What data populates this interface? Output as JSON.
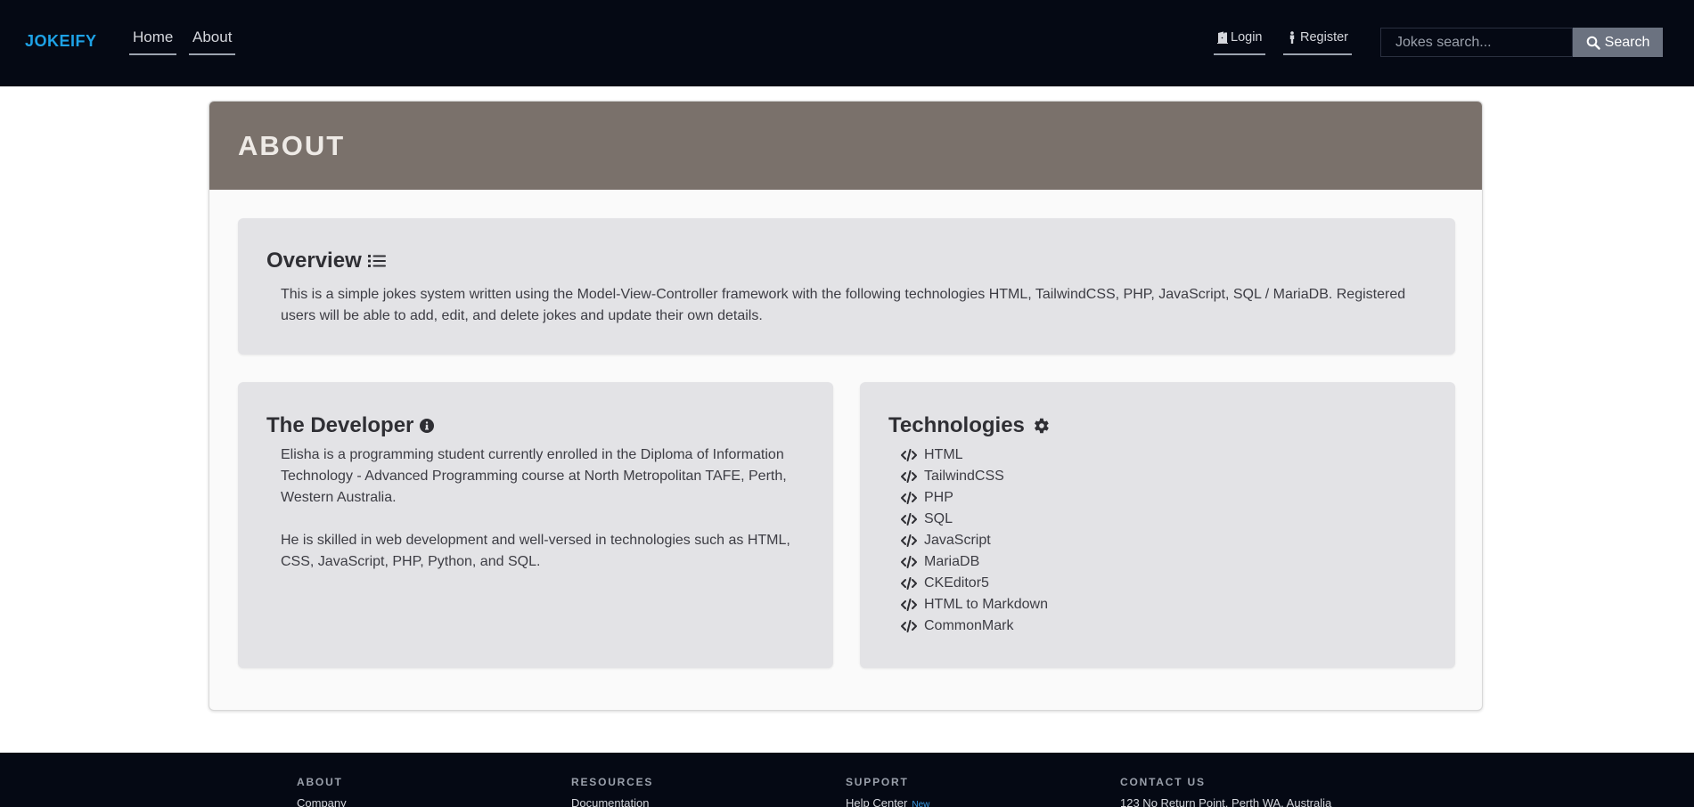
{
  "header": {
    "brand": "JOKEIFY",
    "nav": [
      {
        "label": "Home"
      },
      {
        "label": "About"
      }
    ],
    "login_label": "Login",
    "register_label": "Register",
    "search": {
      "placeholder": "Jokes search...",
      "button_label": "Search"
    }
  },
  "page": {
    "title": "ABOUT",
    "overview": {
      "heading": "Overview",
      "text": "This is a simple jokes system written using the Model-View-Controller framework with the following technologies HTML, TailwindCSS, PHP, JavaScript, SQL / MariaDB. Registered users will be able to add, edit, and delete jokes and update their own details."
    },
    "developer": {
      "heading": "The Developer",
      "paragraphs": [
        "Elisha is a programming student currently enrolled in the Diploma of Information Technology - Advanced Programming course at North Metropolitan TAFE, Perth, Western Australia.",
        "He is skilled in web development and well-versed in technologies such as HTML, CSS, JavaScript, PHP, Python, and SQL."
      ]
    },
    "technologies": {
      "heading": "Technologies",
      "items": [
        "HTML",
        "TailwindCSS",
        "PHP",
        "SQL",
        "JavaScript",
        "MariaDB",
        "CKEditor5",
        "HTML to Markdown",
        "CommonMark"
      ]
    }
  },
  "footer": {
    "columns": [
      {
        "heading": "ABOUT",
        "link": "Company"
      },
      {
        "heading": "RESOURCES",
        "link": "Documentation"
      },
      {
        "heading": "SUPPORT",
        "link": "Help Center",
        "badge": "New"
      },
      {
        "heading": "CONTACT US",
        "link": "123 No Return Point, Perth WA, Australia"
      }
    ]
  },
  "colors": {
    "header_bg": "#050914",
    "brand": "#1ea2e6",
    "page_header_bg": "#7a716b",
    "panel_bg": "#e3e3e6",
    "search_button_bg": "#6b7280"
  },
  "icons": {
    "login": "door-open-icon",
    "register": "person-icon",
    "search": "magnifier-icon",
    "overview": "list-icon",
    "developer": "info-circle-icon",
    "technologies": "gear-icon",
    "tech_item": "code-icon"
  }
}
